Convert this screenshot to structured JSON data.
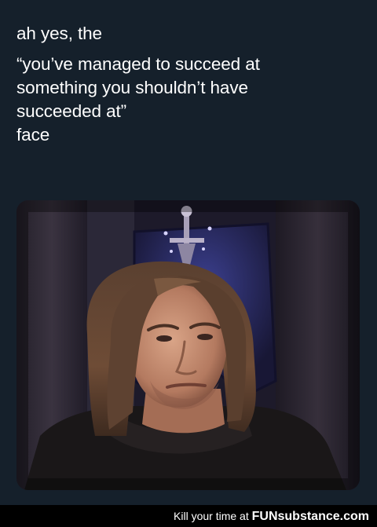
{
  "tweet": {
    "lines": [
      "ah yes, the",
      "“you’ve managed to succeed at",
      "something you shouldn’t have",
      "succeeded at”",
      "face"
    ]
  },
  "media": {
    "icon": "person-photo"
  },
  "footer": {
    "tagline": "Kill your time at",
    "brand": "FUNsubstance.com",
    "background": "#000000"
  },
  "colors": {
    "background": "#15202b",
    "text": "#ffffff"
  }
}
